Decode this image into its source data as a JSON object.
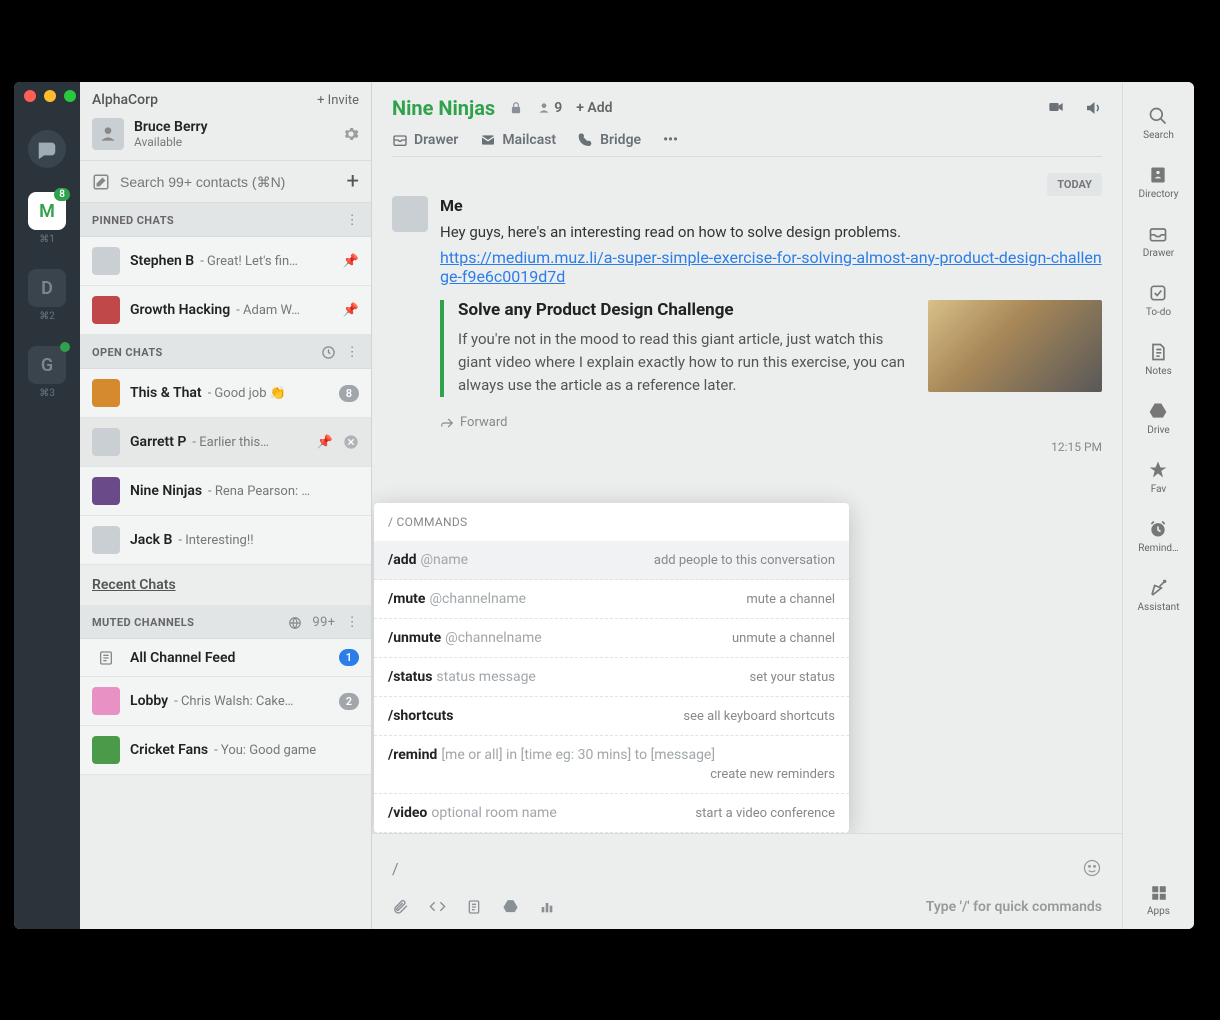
{
  "rail": {
    "workspaces": [
      {
        "letter": "M",
        "shortcut": "⌘1",
        "badge": "8",
        "active": true
      },
      {
        "letter": "D",
        "shortcut": "⌘2",
        "badge": "",
        "active": false
      },
      {
        "letter": "G",
        "shortcut": "⌘3",
        "badge": "",
        "active": false,
        "dot": true
      }
    ]
  },
  "sidebar": {
    "org": "AlphaCorp",
    "invite": "+ Invite",
    "user_name": "Bruce Berry",
    "user_status": "Available",
    "search_placeholder": "Search 99+ contacts (⌘N)",
    "sections": {
      "pinned": "PINNED CHATS",
      "open": "OPEN CHATS",
      "muted": "MUTED CHANNELS"
    },
    "muted_count": "99+",
    "pinned": [
      {
        "name": "Stephen B",
        "preview": "- Great! Let's fin…"
      },
      {
        "name": "Growth Hacking",
        "preview": "- Adam W…"
      }
    ],
    "open": [
      {
        "name": "This & That",
        "preview": "- Good job 👏",
        "badge": "8"
      },
      {
        "name": "Garrett P",
        "preview": "- Earlier this…",
        "pinned": true,
        "closable": true,
        "sel": true
      },
      {
        "name": "Nine Ninjas",
        "preview": "- Rena Pearson: …"
      },
      {
        "name": "Jack B",
        "preview": "- Interesting!!"
      }
    ],
    "recent_link": "Recent Chats",
    "muted": [
      {
        "name": "All Channel Feed",
        "preview": "",
        "badge": "1",
        "blue": true
      },
      {
        "name": "Lobby",
        "preview": "- Chris Walsh: Cake…",
        "badge": "2"
      },
      {
        "name": "Cricket Fans",
        "preview": "- You: Good game"
      }
    ]
  },
  "main": {
    "title": "Nine Ninjas",
    "member_count": "9",
    "add_label": "+ Add",
    "tabs": {
      "drawer": "Drawer",
      "mailcast": "Mailcast",
      "bridge": "Bridge"
    },
    "date_chip": "TODAY",
    "message": {
      "author": "Me",
      "text": "Hey guys, here's an interesting read on how to solve design problems.",
      "link": "https://medium.muz.li/a-super-simple-exercise-for-solving-almost-any-product-design-challenge-f9e6c0019d7d",
      "preview_title": "Solve any Product Design Challenge",
      "preview_desc": "If you're not in the mood to read this giant article, just watch this giant video where I explain exactly how to run this exercise, you can always use the article as a reference later.",
      "forward": "Forward",
      "time": "12:15 PM"
    },
    "commands_header": "/ COMMANDS",
    "commands": [
      {
        "cmd": "/add",
        "arg": "@name",
        "desc": "add people to this conversation",
        "sel": true
      },
      {
        "cmd": "/mute",
        "arg": "@channelname",
        "desc": "mute a channel"
      },
      {
        "cmd": "/unmute",
        "arg": "@channelname",
        "desc": "unmute a channel"
      },
      {
        "cmd": "/status",
        "arg": "status message",
        "desc": "set your status"
      },
      {
        "cmd": "/shortcuts",
        "arg": "",
        "desc": "see all keyboard shortcuts"
      },
      {
        "cmd": "/remind",
        "arg": "[me or all] in [time eg: 30 mins] to [message]",
        "desc": "create new reminders",
        "tall": true
      },
      {
        "cmd": "/video",
        "arg": "optional room name",
        "desc": "start a video conference"
      }
    ],
    "compose_value": "/",
    "compose_hint": "Type '/' for quick commands"
  },
  "rrail": [
    {
      "icon": "search",
      "label": "Search"
    },
    {
      "icon": "directory",
      "label": "Directory"
    },
    {
      "icon": "drawer",
      "label": "Drawer"
    },
    {
      "icon": "todo",
      "label": "To-do"
    },
    {
      "icon": "notes",
      "label": "Notes"
    },
    {
      "icon": "drive",
      "label": "Drive"
    },
    {
      "icon": "fav",
      "label": "Fav"
    },
    {
      "icon": "remind",
      "label": "Remind…"
    },
    {
      "icon": "assistant",
      "label": "Assistant"
    }
  ],
  "rrail_apps": "Apps"
}
